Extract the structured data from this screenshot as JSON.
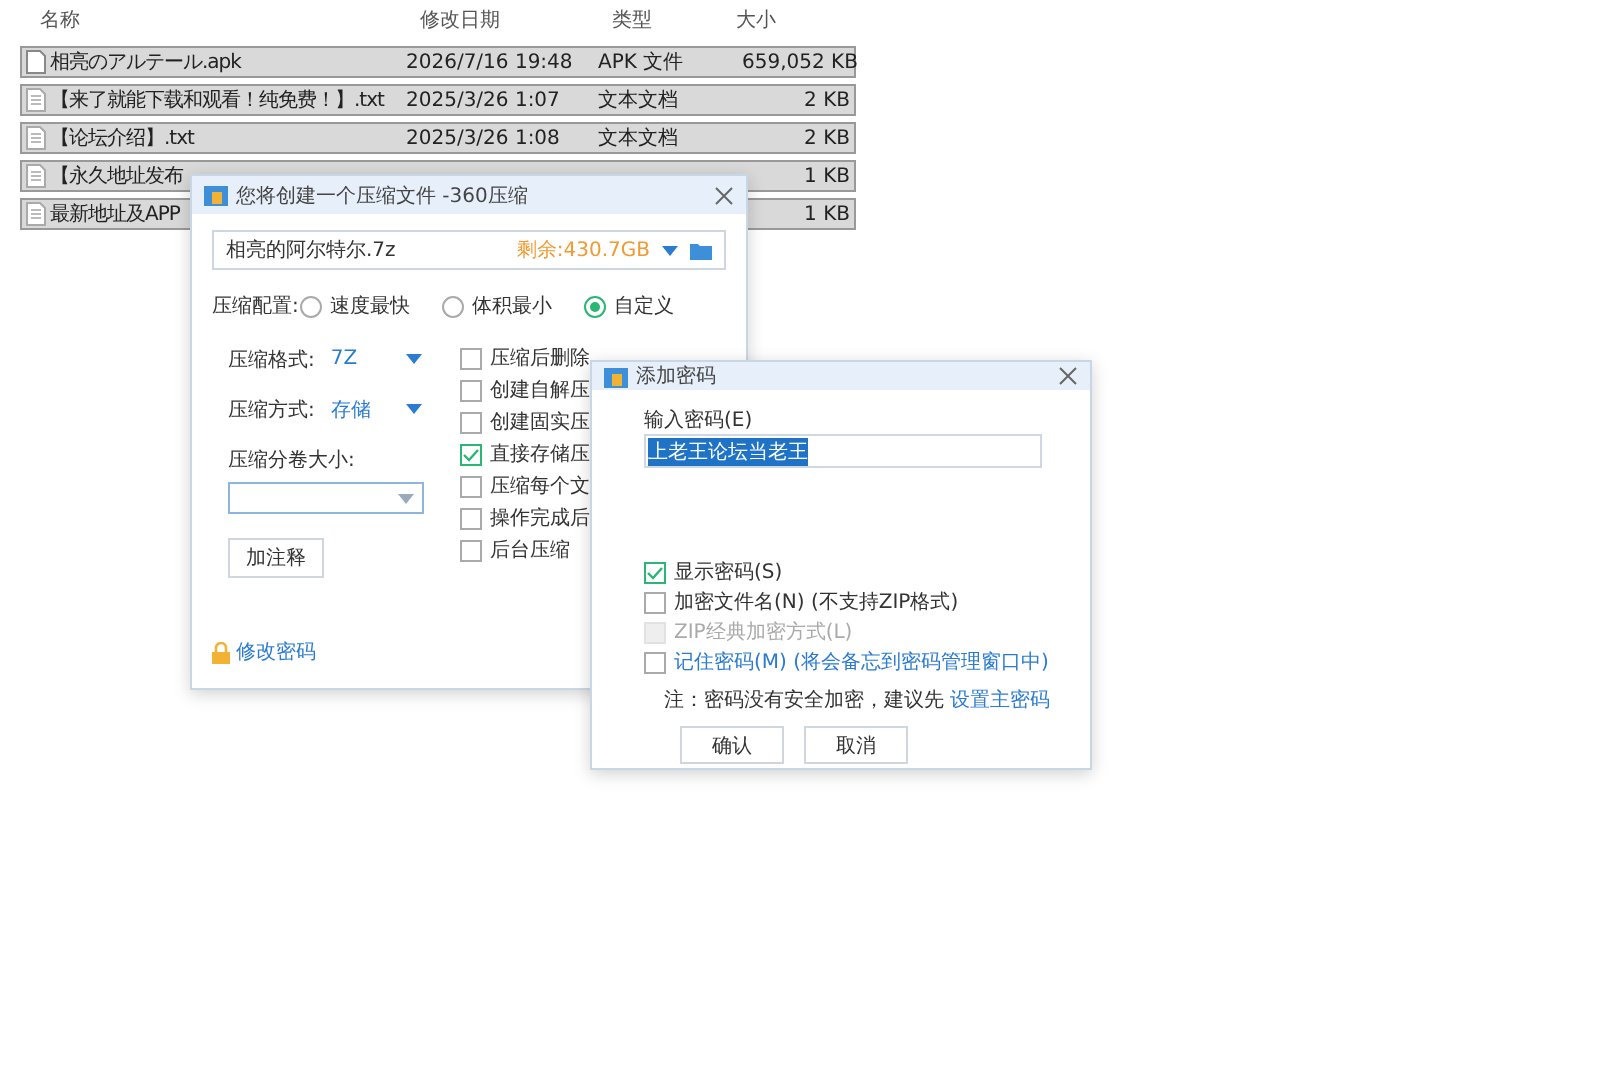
{
  "file_list": {
    "columns": [
      "名称",
      "修改日期",
      "类型",
      "大小"
    ],
    "rows": [
      {
        "kind": "apk",
        "name": "相亮のアルテール.apk",
        "date": "2026/7/16 19:48",
        "type": "APK 文件",
        "size": "659,052 KB",
        "selected": true
      },
      {
        "kind": "txt",
        "name": "【来了就能下载和观看！纯免费！】.txt",
        "date": "2025/3/26 1:07",
        "type": "文本文档",
        "size": "2 KB",
        "selected": true
      },
      {
        "kind": "txt",
        "name": "【论坛介绍】.txt",
        "date": "2025/3/26 1:08",
        "type": "文本文档",
        "size": "2 KB",
        "selected": true
      },
      {
        "kind": "txt",
        "name": "【永久地址发布",
        "size": "1 KB",
        "selected": true
      },
      {
        "kind": "txt",
        "name": "最新地址及APP",
        "size": "1 KB",
        "selected": true
      }
    ]
  },
  "compress_dialog": {
    "title": "您将创建一个压缩文件 -360压缩",
    "filename": "相亮的阿尔特尔.7z",
    "free_space": "剩余:430.7GB",
    "profile_label": "压缩配置:",
    "profiles": [
      {
        "label": "速度最快",
        "selected": false
      },
      {
        "label": "体积最小",
        "selected": false
      },
      {
        "label": "自定义",
        "selected": true
      }
    ],
    "format_label": "压缩格式:",
    "format": "7Z",
    "method_label": "压缩方式:",
    "method": "存储",
    "split_label": "压缩分卷大小:",
    "comment_button": "加注释",
    "options": [
      {
        "label": "压缩后删除",
        "checked": false
      },
      {
        "label": "创建自解压",
        "checked": false
      },
      {
        "label": "创建固实压",
        "checked": false
      },
      {
        "label": "直接存储压",
        "checked": true
      },
      {
        "label": "压缩每个文",
        "checked": false
      },
      {
        "label": "操作完成后",
        "checked": false
      },
      {
        "label": "后台压缩",
        "checked": false
      }
    ],
    "password_link": "修改密码"
  },
  "password_dialog": {
    "title": "添加密码",
    "input_label": "输入密码(E)",
    "password": "上老王论坛当老王",
    "options": [
      {
        "label": "显示密码(S)",
        "checked": true,
        "disabled": false,
        "link": false
      },
      {
        "label": "加密文件名(N) (不支持ZIP格式)",
        "checked": false,
        "disabled": false,
        "link": false
      },
      {
        "label": "ZIP经典加密方式(L)",
        "checked": false,
        "disabled": true,
        "link": false
      },
      {
        "label": "记住密码(M) (将会备忘到密码管理窗口中)",
        "checked": false,
        "disabled": false,
        "link": true
      }
    ],
    "note": "注：密码没有安全加密，建议先",
    "note_link": "设置主密码",
    "ok": "确认",
    "cancel": "取消"
  }
}
